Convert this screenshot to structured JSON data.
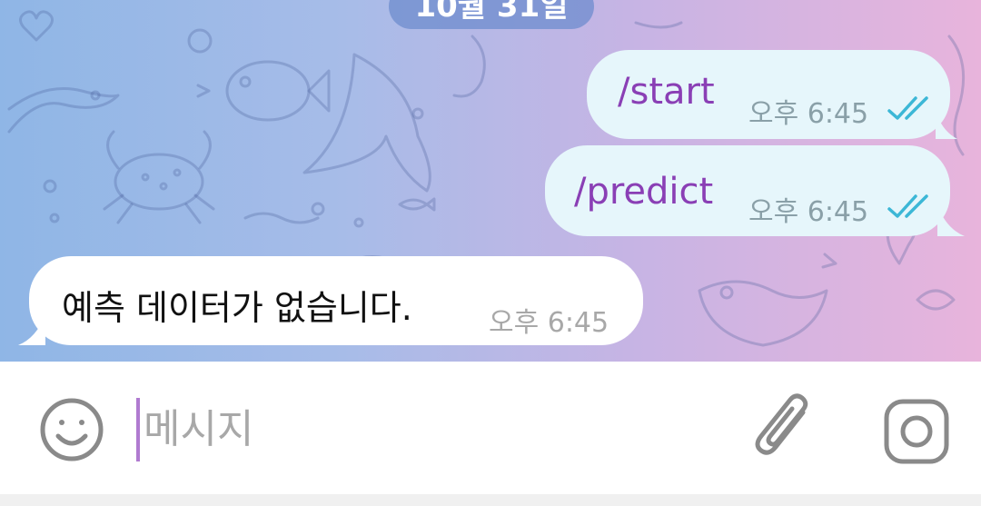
{
  "date_divider": "10월 31일",
  "messages": [
    {
      "type": "outgoing",
      "text": "/start",
      "time": "오후 6:45",
      "status": "read"
    },
    {
      "type": "outgoing",
      "text": "/predict",
      "time": "오후 6:45",
      "status": "read"
    },
    {
      "type": "incoming",
      "text": "예측 데이터가 없습니다.",
      "time": "오후 6:45"
    }
  ],
  "composer": {
    "placeholder": "메시지",
    "emoji_icon": "smiley-icon",
    "attach_icon": "paperclip-icon",
    "camera_icon": "instagram-camera-icon"
  },
  "colors": {
    "command": "#8a3fb5",
    "outgoing_bubble": "#e6f6fb",
    "incoming_bubble": "#ffffff",
    "read_ticks": "#3cb7d6",
    "caret": "#b07ad0"
  }
}
